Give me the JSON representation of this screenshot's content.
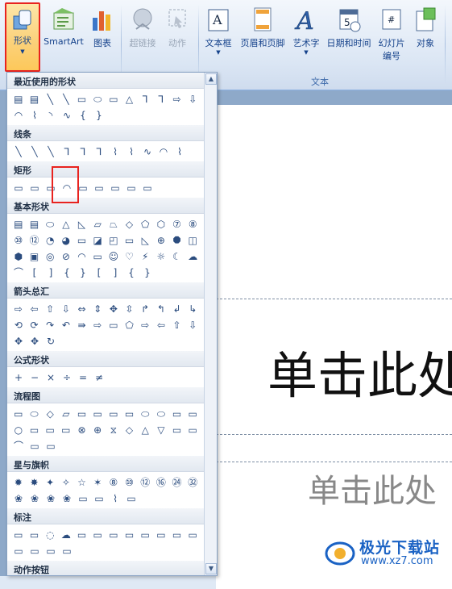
{
  "ribbon": {
    "buttons": [
      {
        "label": "形状",
        "has_dropdown": true
      },
      {
        "label": "SmartArt"
      },
      {
        "label": "图表"
      },
      {
        "label": "超链接",
        "disabled": true
      },
      {
        "label": "动作",
        "disabled": true
      },
      {
        "label": "文本框",
        "has_dropdown": true
      },
      {
        "label": "页眉和页脚"
      },
      {
        "label": "艺术字",
        "has_dropdown": true
      },
      {
        "label": "日期和时间"
      },
      {
        "label": "幻灯片编号",
        "line1": "幻灯片",
        "line2": "编号"
      },
      {
        "label": "对象"
      }
    ],
    "groups": {
      "text": "文本"
    }
  },
  "gallery": {
    "sections": [
      {
        "title": "最近使用的形状",
        "glyphs": [
          "▤▤╲╲▭⬭▭△⅂⅂⇨⇩",
          "◠⌇◝∿{}"
        ]
      },
      {
        "title": "线条",
        "glyphs": [
          "╲╲╲⅂⅂⅂⌇⌇∿◠⌇"
        ]
      },
      {
        "title": "矩形",
        "glyphs": [
          "▭▭▭◠▭▭▭▭▭"
        ]
      },
      {
        "title": "基本形状",
        "glyphs": [
          "▤▤⬭△◺▱⏢◇⬠⬡⑦⑧",
          "⑩⑫◔◕▭◪◰▭◺⊕⯃◫",
          "⬢▣◎⊘◠▭☺♡⚡☼☾☁",
          "⌒[]{}[]{}"
        ]
      },
      {
        "title": "箭头总汇",
        "glyphs": [
          "⇨⇦⇧⇩⇔⇕✥⇳↱↰↲↳",
          "⟲⟳↷↶⇛⇨▭⬠⇨⇦⇧⇩",
          "✥✥↻"
        ]
      },
      {
        "title": "公式形状",
        "glyphs": [
          "+−×÷=≠"
        ]
      },
      {
        "title": "流程图",
        "glyphs": [
          "▭⬭◇▱▭▭▭▭⬭⬭▭▭",
          "○▭▭▭⊗⊕⧖◇△▽▭▭",
          "⌒▭▭"
        ]
      },
      {
        "title": "星与旗帜",
        "glyphs": [
          "✹✸✦✧☆✶⑧⑩⑫⑯㉔㉜",
          "❀❀❀❀▭▭⌇▭"
        ]
      },
      {
        "title": "标注",
        "glyphs": [
          "▭▭◌☁▭▭▭▭▭▭▭▭",
          "▭▭▭▭"
        ]
      },
      {
        "title": "动作按钮",
        "glyphs": [
          "◁▷⏮⏭⌂ⓘ⎌▭▭▭?▭"
        ]
      }
    ]
  },
  "slide": {
    "title_placeholder": "单击此处",
    "subtitle_placeholder": "单击此处"
  },
  "watermark": {
    "brand": "极光下载站",
    "url": "www.xz7.com"
  },
  "colors": {
    "highlight": "#e8231f",
    "ribbon_text": "#15428b"
  }
}
